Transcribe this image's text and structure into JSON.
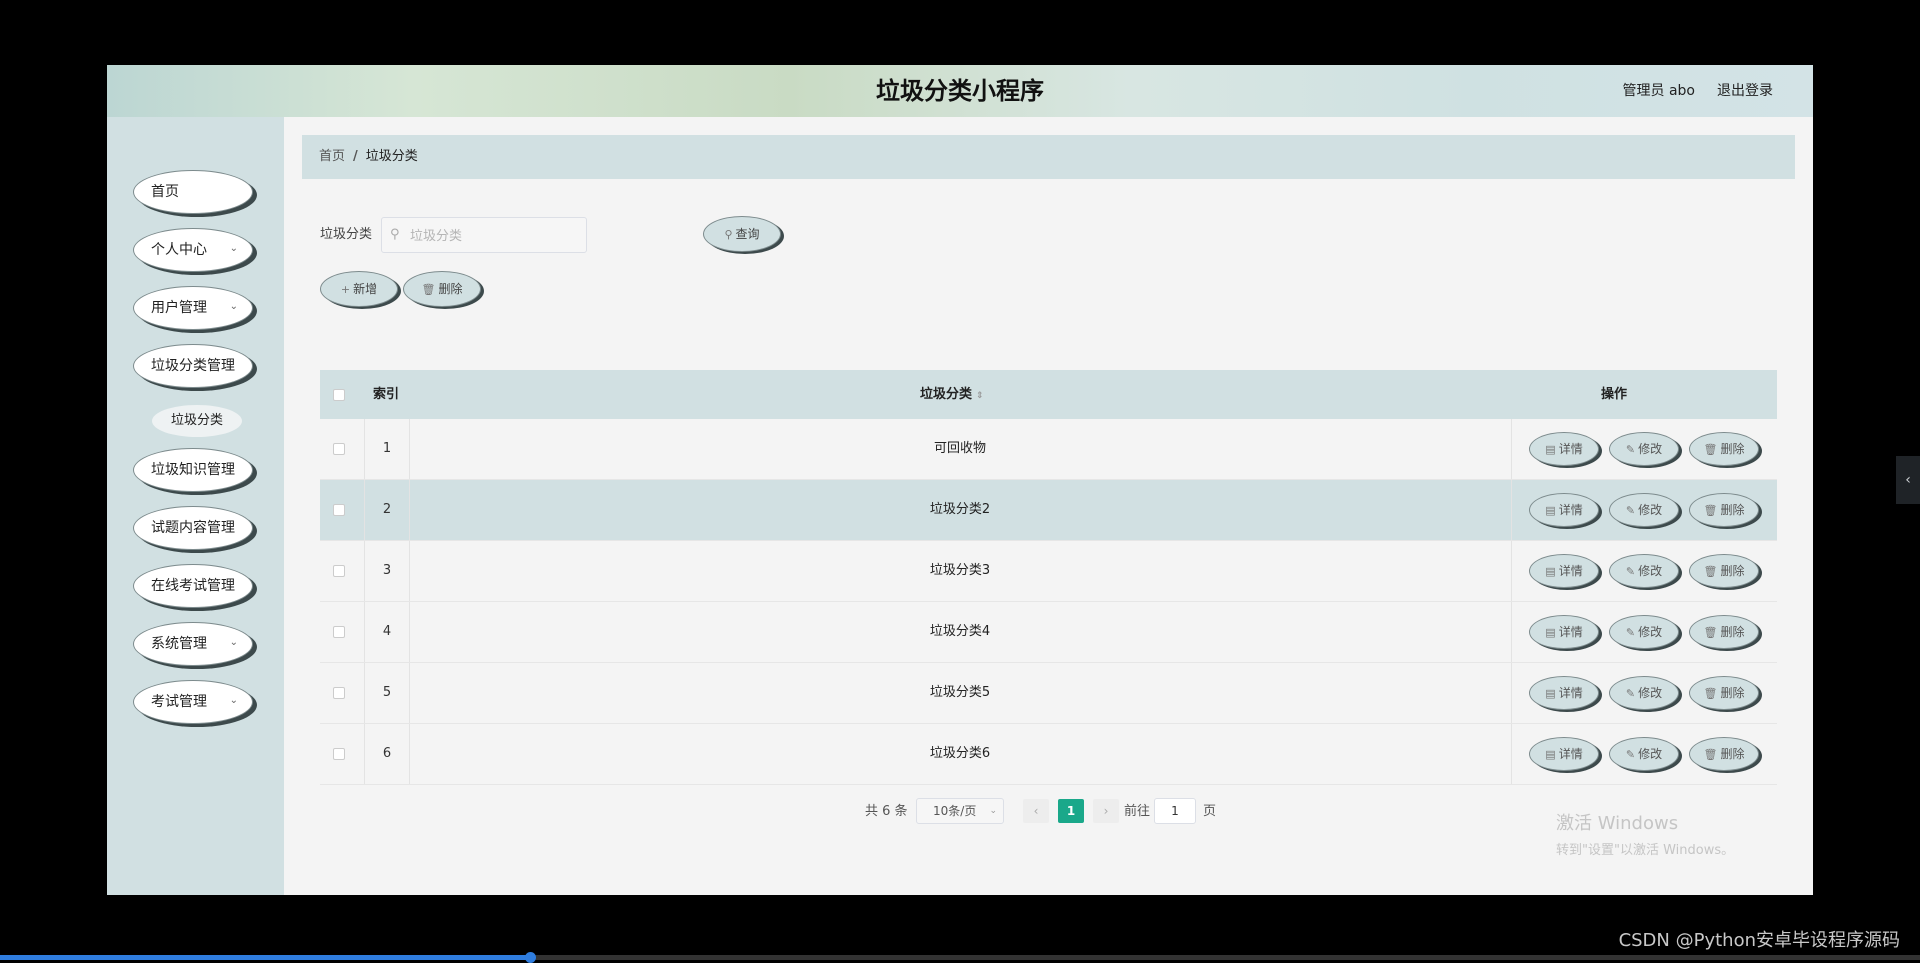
{
  "header": {
    "title": "垃圾分类小程序",
    "user": "管理员 abo",
    "logout": "退出登录"
  },
  "sidebar": {
    "items": [
      {
        "label": "首页",
        "has_arrow": false
      },
      {
        "label": "个人中心",
        "has_arrow": true
      },
      {
        "label": "用户管理",
        "has_arrow": true
      },
      {
        "label": "垃圾分类管理",
        "has_arrow": false
      },
      {
        "label": "垃圾知识管理",
        "has_arrow": false
      },
      {
        "label": "试题内容管理",
        "has_arrow": false
      },
      {
        "label": "在线考试管理",
        "has_arrow": false
      },
      {
        "label": "系统管理",
        "has_arrow": true
      },
      {
        "label": "考试管理",
        "has_arrow": true
      }
    ],
    "subitem": "垃圾分类"
  },
  "breadcrumb": {
    "home": "首页",
    "separator": "/",
    "current": "垃圾分类"
  },
  "search": {
    "label": "垃圾分类",
    "placeholder": "垃圾分类",
    "value": "",
    "query_button": "查询"
  },
  "toolbar": {
    "add": "新增",
    "delete": "删除"
  },
  "table": {
    "headers": {
      "index": "索引",
      "category": "垃圾分类",
      "actions": "操作"
    },
    "rows": [
      {
        "index": "1",
        "name": "可回收物"
      },
      {
        "index": "2",
        "name": "垃圾分类2"
      },
      {
        "index": "3",
        "name": "垃圾分类3"
      },
      {
        "index": "4",
        "name": "垃圾分类4"
      },
      {
        "index": "5",
        "name": "垃圾分类5"
      },
      {
        "index": "6",
        "name": "垃圾分类6"
      }
    ],
    "actions": {
      "detail": "详情",
      "edit": "修改",
      "delete": "删除"
    }
  },
  "pagination": {
    "total": "共 6 条",
    "page_size": "10条/页",
    "current_page": "1",
    "goto": "前往",
    "goto_value": "1",
    "page_unit": "页"
  },
  "watermark": {
    "line1": "激活 Windows",
    "line2": "转到\"设置\"以激活 Windows。"
  },
  "footer_credit": "CSDN @Python安卓毕设程序源码",
  "video_progress": 0.276,
  "colors": {
    "accent": "#1aa88a",
    "panel": "#d1e0e2",
    "shadow": "#3d4a4c"
  }
}
